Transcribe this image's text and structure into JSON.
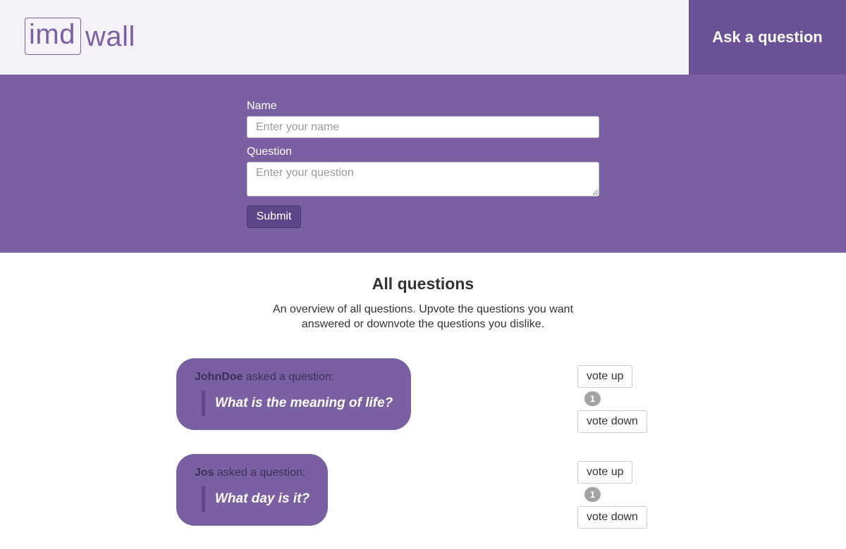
{
  "header": {
    "logo_boxed": "imd",
    "logo_rest": "wall",
    "ask_label": "Ask a question"
  },
  "form": {
    "name_label": "Name",
    "name_placeholder": "Enter your name",
    "name_value": "",
    "question_label": "Question",
    "question_placeholder": "Enter your question",
    "question_value": "",
    "submit_label": "Submit"
  },
  "questions_section": {
    "title": "All questions",
    "description": "An overview of all questions. Upvote the questions you want answered or downvote the questions you dislike."
  },
  "questions": [
    {
      "asker": "JohnDoe",
      "asked_suffix": " asked a question:",
      "text": "What is the meaning of life?",
      "vote_up_label": "vote up",
      "votes": "1",
      "vote_down_label": "vote down"
    },
    {
      "asker": "Jos",
      "asked_suffix": " asked a question:",
      "text": "What day is it?",
      "vote_up_label": "vote up",
      "votes": "1",
      "vote_down_label": "vote down"
    }
  ],
  "colors": {
    "brand_purple": "#7a60a3",
    "header_bg": "#f4f1f8",
    "ask_button_bg": "#6b5196",
    "submit_bg": "#5d4788",
    "vote_badge": "#a3a3a3"
  }
}
